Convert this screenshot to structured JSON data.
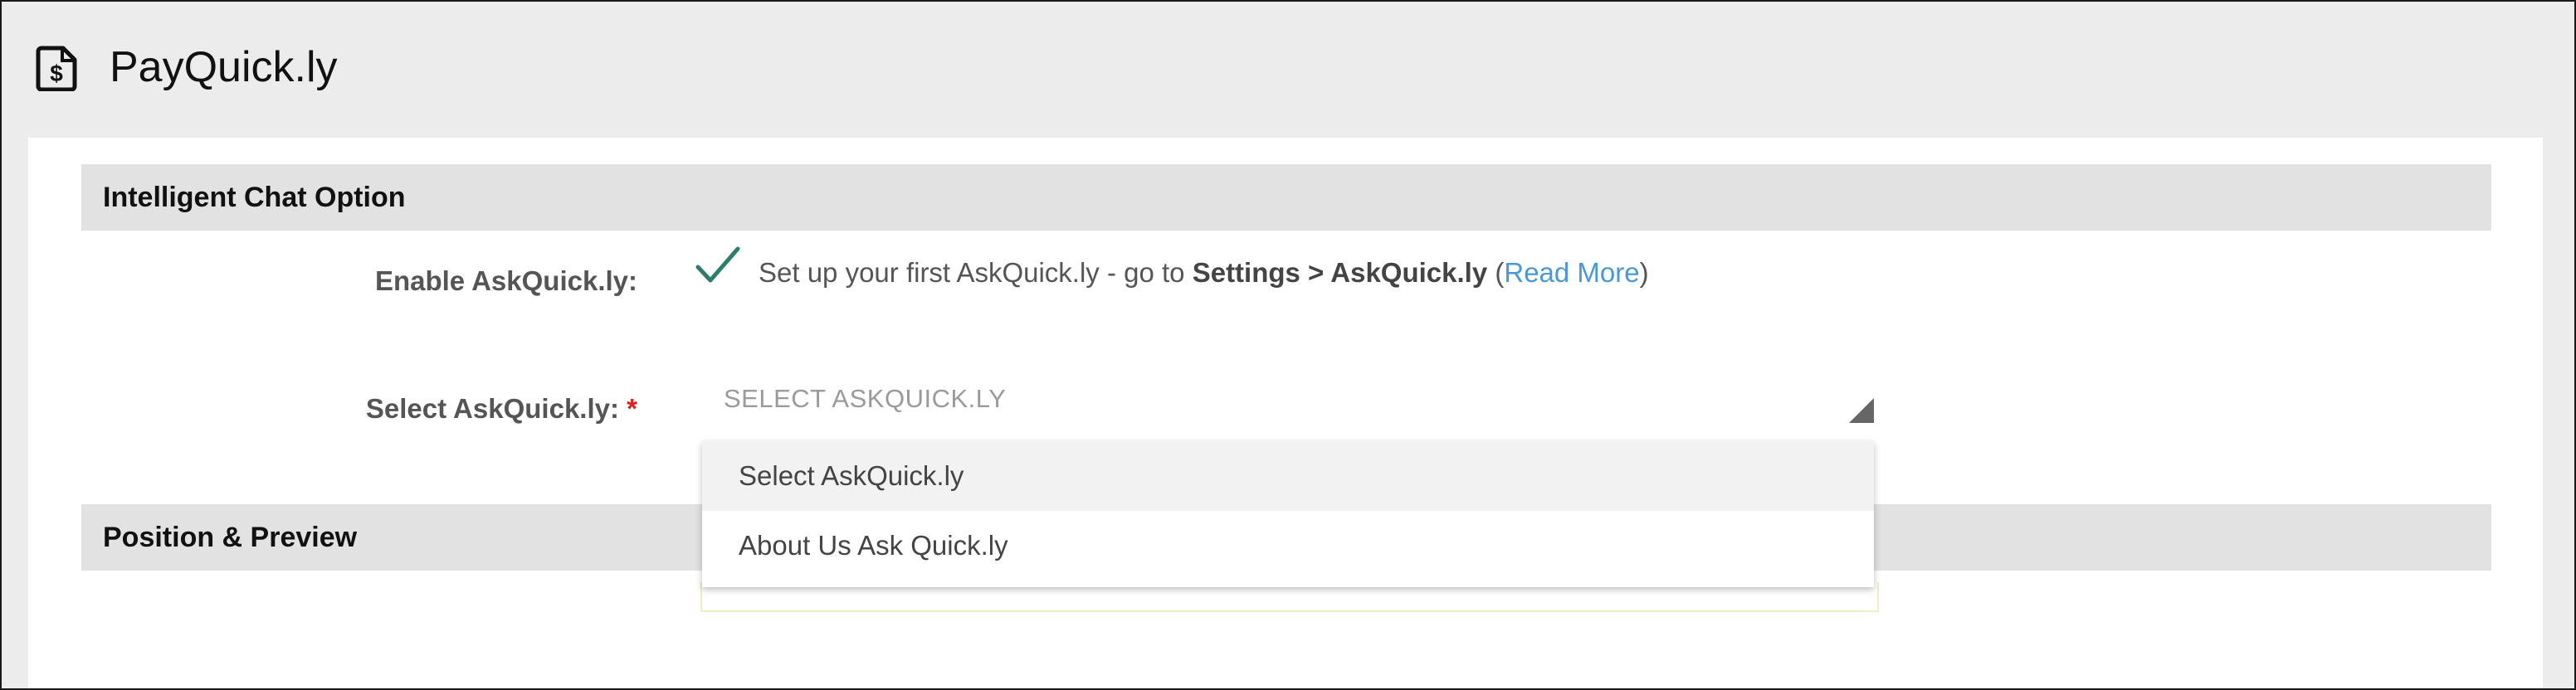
{
  "app": {
    "title": "PayQuick.ly",
    "logo_icon": "dollar-document-icon"
  },
  "sections": {
    "chat": {
      "title": "Intelligent Chat Option"
    },
    "position": {
      "title": "Position & Preview"
    }
  },
  "enable": {
    "label": "Enable AskQuick.ly:",
    "icon": "checkmark-icon",
    "text_before": "Set up your first AskQuick.ly - go to ",
    "text_bold": "Settings > AskQuick.ly",
    "text_open": " (",
    "link": "Read More",
    "text_close": ")"
  },
  "select": {
    "label": "Select AskQuick.ly:",
    "required": "*",
    "placeholder": "SELECT ASKQUICK.LY",
    "options": [
      "Select AskQuick.ly",
      "About Us Ask Quick.ly"
    ]
  },
  "colors": {
    "check": "#2e7d6b",
    "link": "#4a98d8",
    "required": "#e02020",
    "section_bar": "#e2e2e2",
    "header_bg": "#ececec"
  }
}
